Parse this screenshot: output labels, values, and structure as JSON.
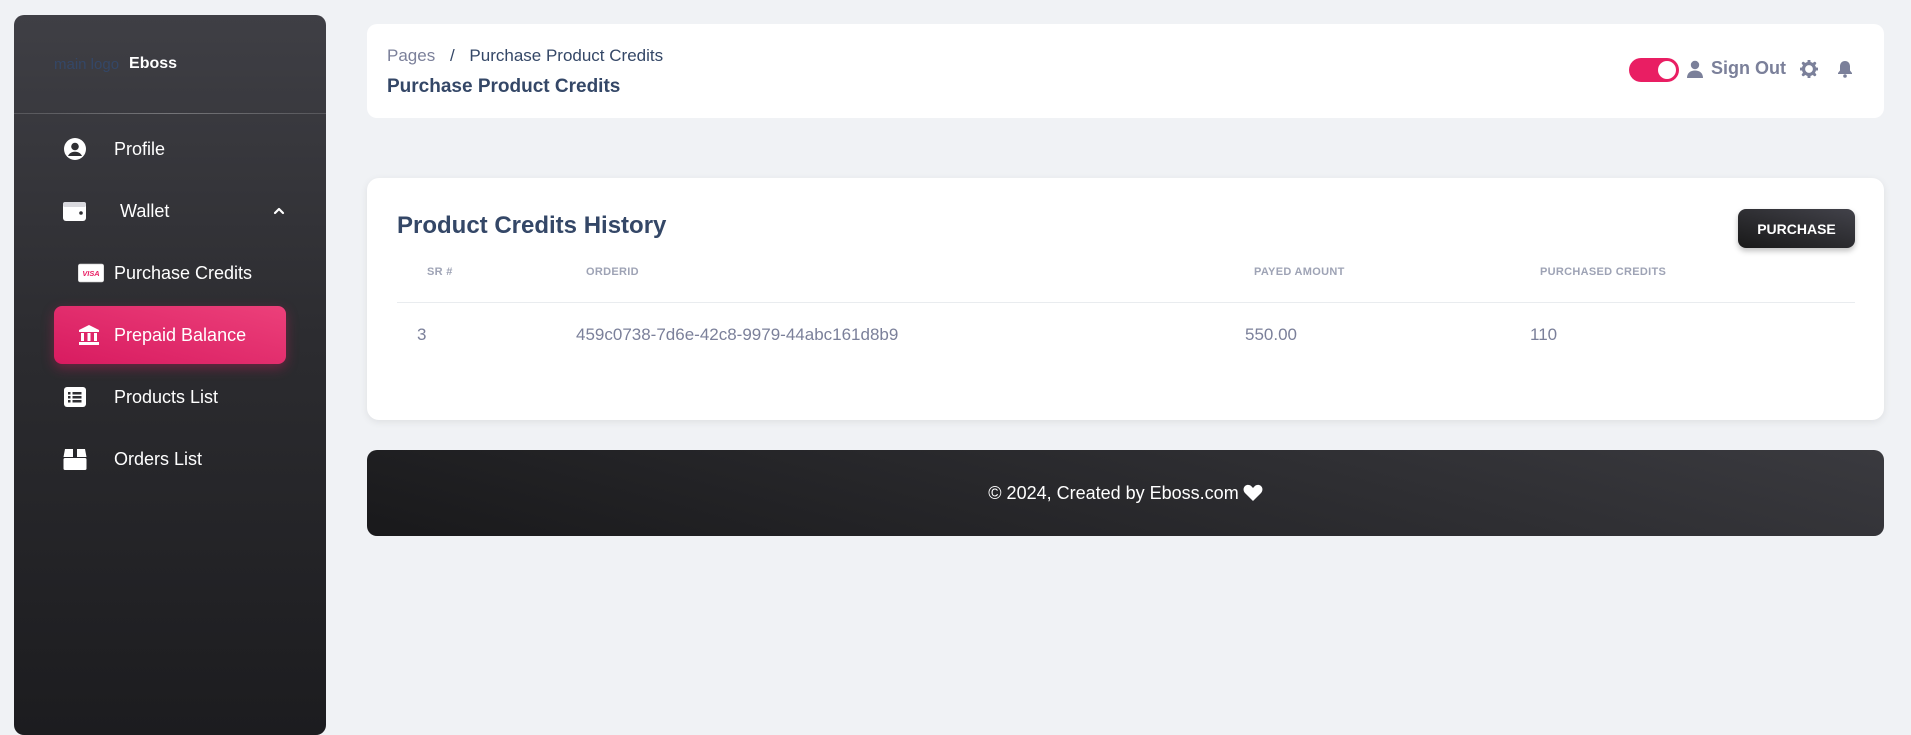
{
  "sidebar": {
    "logo_alt": "main logo",
    "brand": "Eboss",
    "items": [
      {
        "label": "Profile",
        "icon": "user-circle-icon"
      },
      {
        "label": "Wallet",
        "icon": "wallet-icon",
        "expanded": true
      },
      {
        "label": "Purchase Credits",
        "icon": "visa-card-icon"
      },
      {
        "label": "Prepaid Balance",
        "icon": "bank-icon",
        "active": true
      },
      {
        "label": "Products List",
        "icon": "list-icon"
      },
      {
        "label": "Orders List",
        "icon": "box-icon"
      }
    ]
  },
  "header": {
    "breadcrumb_root": "Pages",
    "breadcrumb_separator": "/",
    "breadcrumb_current": "Purchase Product Credits",
    "title": "Purchase Product Credits",
    "signout_label": "Sign Out",
    "toggle_on": true
  },
  "card": {
    "title": "Product Credits History",
    "purchase_button": "PURCHASE",
    "columns": [
      "SR #",
      "ORDERID",
      "PAYED AMOUNT",
      "PURCHASED CREDITS"
    ],
    "rows": [
      [
        "3",
        "459c0738-7d6e-42c8-9979-44abc161d8b9",
        "550.00",
        "110"
      ]
    ]
  },
  "footer": {
    "text": "© 2024, Created by Eboss.com"
  },
  "colors": {
    "accent": "#e91e63",
    "heading": "#344767",
    "muted": "#7b809a",
    "dark": "#191919"
  }
}
